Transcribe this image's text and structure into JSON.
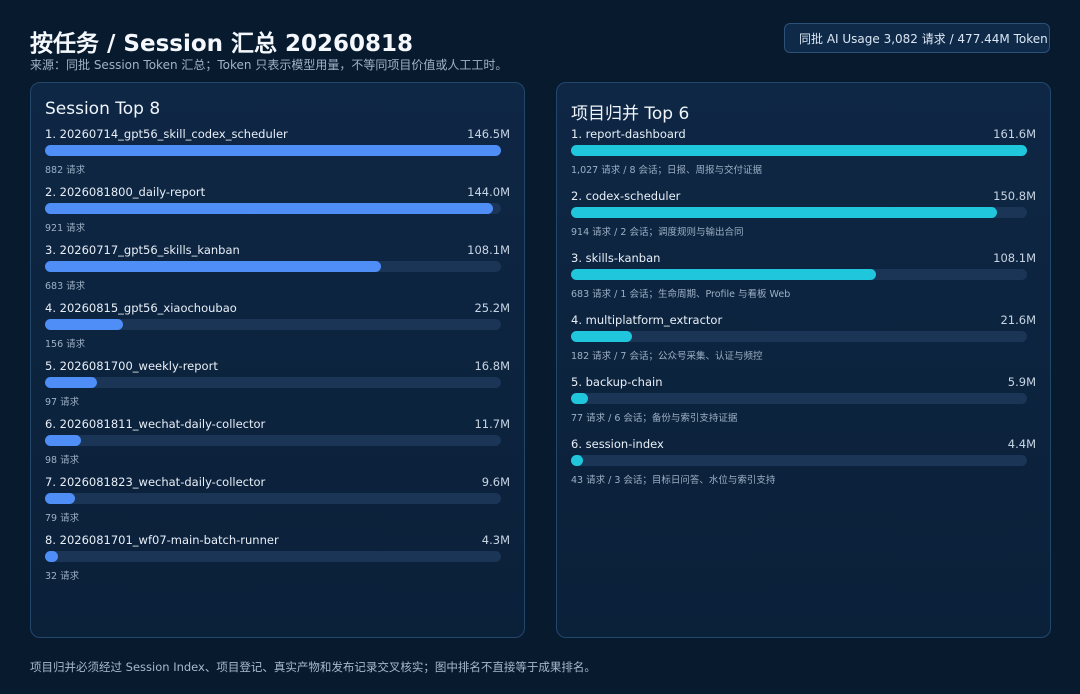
{
  "header": {
    "title": "按任务 / Session 汇总 20260818",
    "subtitle": "来源：同批 Session Token 汇总；Token 只表示模型用量，不等同项目价值或人工工时。",
    "usage_badge": "同批 AI Usage  3,082 请求 / 477.44M Token"
  },
  "footnote": "项目归并必须经过 Session Index、项目登记、真实产物和发布记录交叉核实；图中排名不直接等于成果排名。",
  "chart_data": [
    {
      "type": "bar",
      "orientation": "horizontal",
      "title": "Session Top 8",
      "xlim": [
        0,
        146.5
      ],
      "unit": "M",
      "colors": {
        "bar": "#4f8ef7",
        "track": "#1a3556"
      },
      "items": [
        {
          "label": "1. 20260714_gpt56_skill_codex_scheduler",
          "value": 146.5,
          "value_label": "146.5M",
          "sub": "882 请求"
        },
        {
          "label": "2. 2026081800_daily-report",
          "value": 144.0,
          "value_label": "144.0M",
          "sub": "921 请求"
        },
        {
          "label": "3. 20260717_gpt56_skills_kanban",
          "value": 108.1,
          "value_label": "108.1M",
          "sub": "683 请求"
        },
        {
          "label": "4. 20260815_gpt56_xiaochoubao",
          "value": 25.2,
          "value_label": "25.2M",
          "sub": "156 请求"
        },
        {
          "label": "5. 2026081700_weekly-report",
          "value": 16.8,
          "value_label": "16.8M",
          "sub": "97 请求"
        },
        {
          "label": "6. 2026081811_wechat-daily-collector",
          "value": 11.7,
          "value_label": "11.7M",
          "sub": "98 请求"
        },
        {
          "label": "7. 2026081823_wechat-daily-collector",
          "value": 9.6,
          "value_label": "9.6M",
          "sub": "79 请求"
        },
        {
          "label": "8. 2026081701_wf07-main-batch-runner",
          "value": 4.3,
          "value_label": "4.3M",
          "sub": "32 请求"
        }
      ]
    },
    {
      "type": "bar",
      "orientation": "horizontal",
      "title": "项目归并 Top 6",
      "xlim": [
        0,
        161.6
      ],
      "unit": "M",
      "colors": {
        "bar": "#20c6dc",
        "track": "#1a3556"
      },
      "items": [
        {
          "label": "1. report-dashboard",
          "value": 161.6,
          "value_label": "161.6M",
          "sub": "1,027 请求 / 8 会话；日报、周报与交付证据"
        },
        {
          "label": "2. codex-scheduler",
          "value": 150.8,
          "value_label": "150.8M",
          "sub": "914 请求 / 2 会话；调度规则与输出合同"
        },
        {
          "label": "3. skills-kanban",
          "value": 108.1,
          "value_label": "108.1M",
          "sub": "683 请求 / 1 会话；生命周期、Profile 与看板 Web"
        },
        {
          "label": "4. multiplatform_extractor",
          "value": 21.6,
          "value_label": "21.6M",
          "sub": "182 请求 / 7 会话；公众号采集、认证与频控"
        },
        {
          "label": "5. backup-chain",
          "value": 5.9,
          "value_label": "5.9M",
          "sub": "77 请求 / 6 会话；备份与索引支持证据"
        },
        {
          "label": "6. session-index",
          "value": 4.4,
          "value_label": "4.4M",
          "sub": "43 请求 / 3 会话；目标日问答、水位与索引支持"
        }
      ]
    }
  ]
}
